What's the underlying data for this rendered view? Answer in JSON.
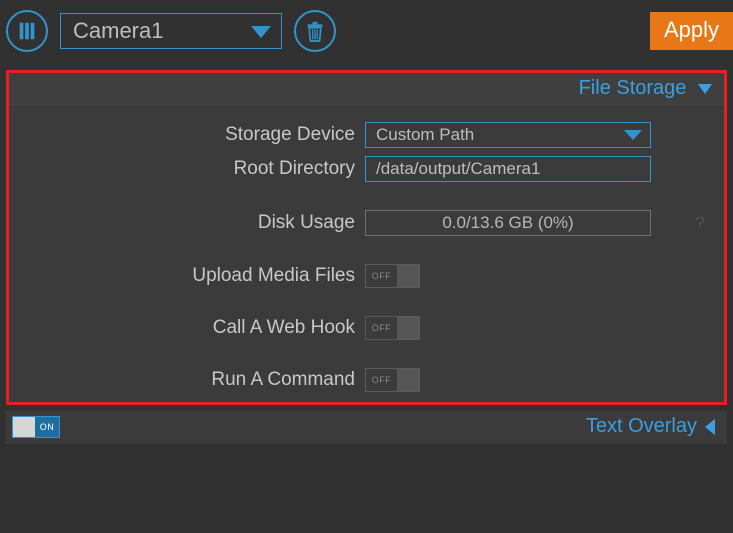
{
  "topbar": {
    "camera_name": "Camera1",
    "apply_label": "Apply"
  },
  "section_file_storage": {
    "header": "File Storage",
    "storage_device_label": "Storage Device",
    "storage_device_value": "Custom Path",
    "root_directory_label": "Root Directory",
    "root_directory_value": "/data/output/Camera1",
    "disk_usage_label": "Disk Usage",
    "disk_usage_value": "0.0/13.6 GB (0%)",
    "upload_media_label": "Upload Media Files",
    "upload_media_state": "OFF",
    "webhook_label": "Call A Web Hook",
    "webhook_state": "OFF",
    "command_label": "Run A Command",
    "command_state": "OFF"
  },
  "section_text_overlay": {
    "header": "Text Overlay",
    "state": "ON"
  }
}
